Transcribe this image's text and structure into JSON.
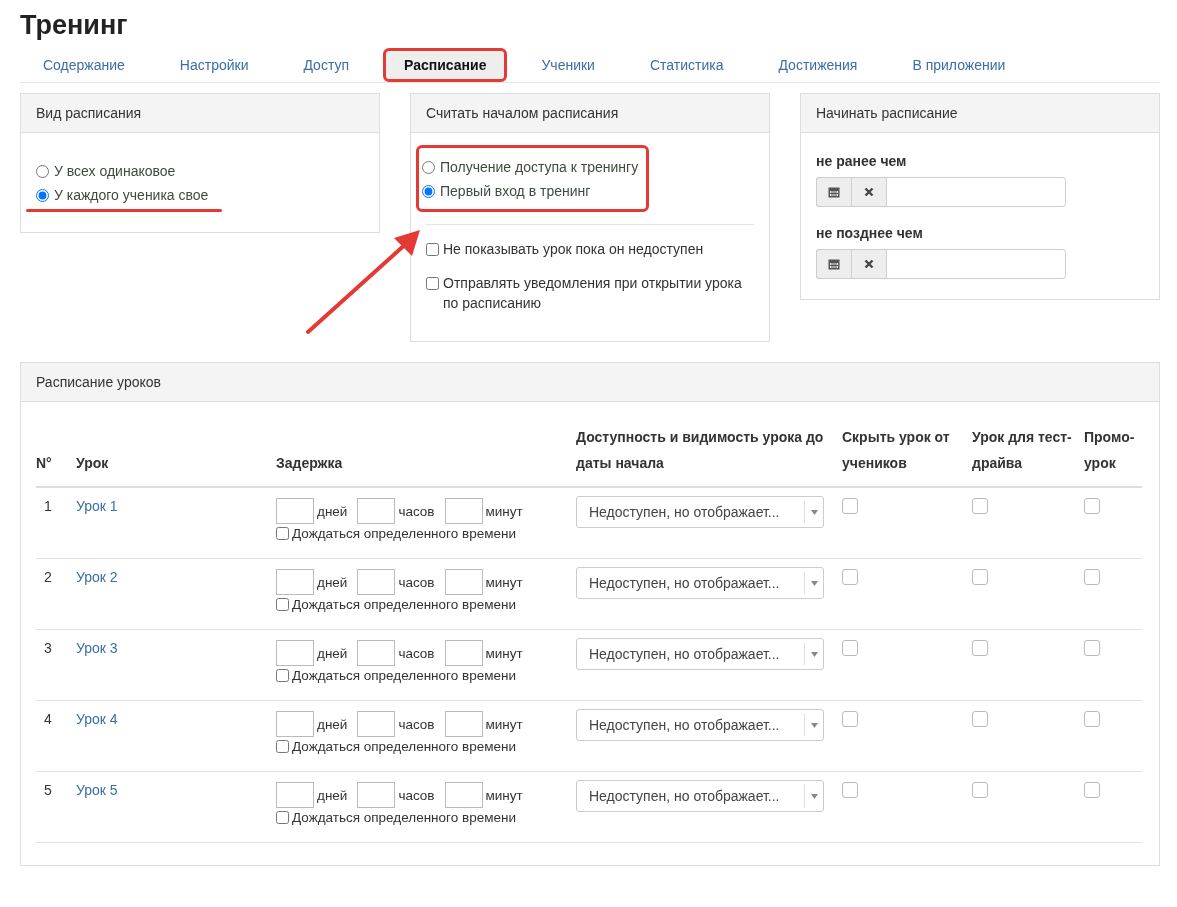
{
  "title": "Тренинг",
  "tabs": [
    {
      "label": "Содержание",
      "selected": false
    },
    {
      "label": "Настройки",
      "selected": false
    },
    {
      "label": "Доступ",
      "selected": false
    },
    {
      "label": "Расписание",
      "selected": true
    },
    {
      "label": "Ученики",
      "selected": false
    },
    {
      "label": "Статистика",
      "selected": false
    },
    {
      "label": "Достижения",
      "selected": false
    },
    {
      "label": "В приложении",
      "selected": false
    }
  ],
  "schedule_type": {
    "title": "Вид расписания",
    "options": [
      {
        "label": "У всех одинаковое",
        "selected": false
      },
      {
        "label": "У каждого ученика свое",
        "selected": true
      }
    ]
  },
  "schedule_start": {
    "title": "Считать началом расписания",
    "options": [
      {
        "label": "Получение доступа к тренингу",
        "selected": false
      },
      {
        "label": "Первый вход в тренинг",
        "selected": true
      }
    ],
    "checkboxes": [
      {
        "label": "Не показывать урок пока он недоступен",
        "checked": false
      },
      {
        "label": "Отправлять уведомления при открытии урока по расписанию",
        "checked": false
      }
    ]
  },
  "start_window": {
    "title": "Начинать расписание",
    "fields": [
      {
        "label": "не ранее чем"
      },
      {
        "label": "не позднее чем"
      }
    ]
  },
  "lessons": {
    "title": "Расписание уроков",
    "columns": [
      "N°",
      "Урок",
      "Задержка",
      "Доступность и видимость урока до даты начала",
      "Скрыть урок от учеников",
      "Урок для тест-драйва",
      "Промо-урок"
    ],
    "rows": [
      {
        "number": "1",
        "name": "Урок 1",
        "units": [
          "дней",
          "часов",
          "минут"
        ],
        "wait_label": "Дождаться определенного времени",
        "wait_checked": false,
        "visibility": "Недоступен, но отображает...",
        "hidden": false,
        "test_drive": false,
        "promo": false
      },
      {
        "number": "2",
        "name": "Урок 2",
        "units": [
          "дней",
          "часов",
          "минут"
        ],
        "wait_label": "Дождаться определенного времени",
        "wait_checked": false,
        "visibility": "Недоступен, но отображает...",
        "hidden": false,
        "test_drive": false,
        "promo": false
      },
      {
        "number": "3",
        "name": "Урок 3",
        "units": [
          "дней",
          "часов",
          "минут"
        ],
        "wait_label": "Дождаться определенного времени",
        "wait_checked": false,
        "visibility": "Недоступен, но отображает...",
        "hidden": false,
        "test_drive": false,
        "promo": false
      },
      {
        "number": "4",
        "name": "Урок 4",
        "units": [
          "дней",
          "часов",
          "минут"
        ],
        "wait_label": "Дождаться определенного времени",
        "wait_checked": false,
        "visibility": "Недоступен, но отображает...",
        "hidden": false,
        "test_drive": false,
        "promo": false
      },
      {
        "number": "5",
        "name": "Урок 5",
        "units": [
          "дней",
          "часов",
          "минут"
        ],
        "wait_label": "Дождаться определенного времени",
        "wait_checked": false,
        "visibility": "Недоступен, но отображает...",
        "hidden": false,
        "test_drive": false,
        "promo": false
      }
    ]
  }
}
